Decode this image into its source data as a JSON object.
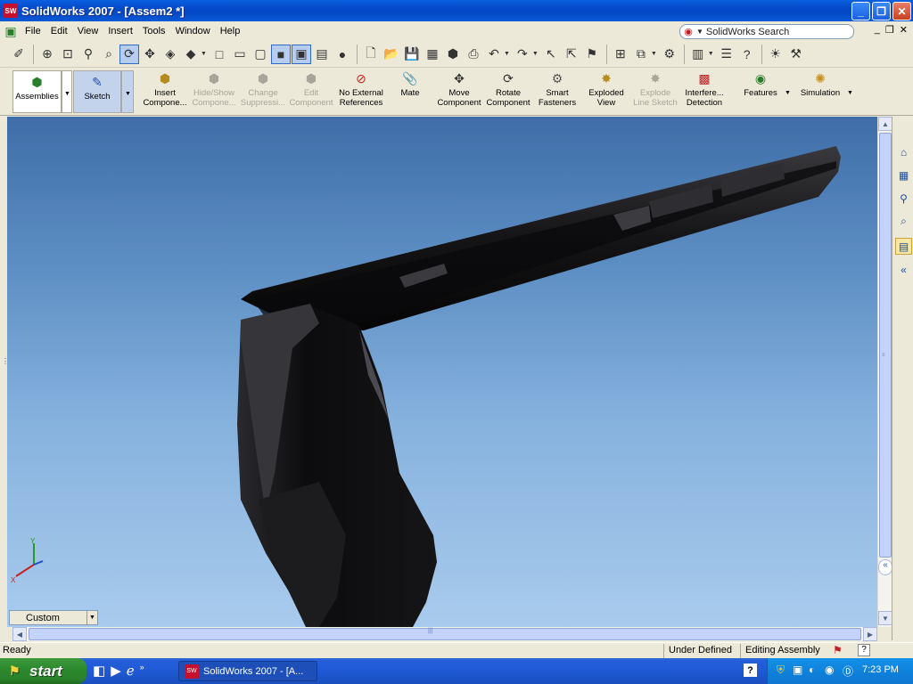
{
  "window": {
    "title": "SolidWorks 2007 - [Assem2 *]",
    "app_icon": "solidworks-logo-icon",
    "controls": [
      "_",
      "❐",
      "✕"
    ]
  },
  "menubar": {
    "items": [
      "File",
      "Edit",
      "View",
      "Insert",
      "Tools",
      "Window",
      "Help"
    ],
    "search_placeholder": "SolidWorks Search",
    "mdi_controls": [
      "_",
      "❐",
      "✕"
    ]
  },
  "command_manager": {
    "items": [
      {
        "label": "Assemblies",
        "icon": "assemblies-icon",
        "state": "tab"
      },
      {
        "label": "Sketch",
        "icon": "sketch-icon",
        "state": "tab-selected"
      },
      {
        "label": "Insert Compone...",
        "icon": "insert-component-icon",
        "state": "enabled"
      },
      {
        "label": "Hide/Show Compone...",
        "icon": "hide-show-component-icon",
        "state": "disabled"
      },
      {
        "label": "Change Suppressi...",
        "icon": "change-suppression-icon",
        "state": "disabled"
      },
      {
        "label": "Edit Component",
        "icon": "edit-component-icon",
        "state": "disabled"
      },
      {
        "label": "No External References",
        "icon": "no-external-references-icon",
        "state": "enabled"
      },
      {
        "label": "Mate",
        "icon": "mate-icon",
        "state": "enabled"
      },
      {
        "label": "Move Component",
        "icon": "move-component-icon",
        "state": "enabled"
      },
      {
        "label": "Rotate Component",
        "icon": "rotate-component-icon",
        "state": "enabled"
      },
      {
        "label": "Smart Fasteners",
        "icon": "smart-fasteners-icon",
        "state": "enabled"
      },
      {
        "label": "Exploded View",
        "icon": "exploded-view-icon",
        "state": "enabled"
      },
      {
        "label": "Explode Line Sketch",
        "icon": "explode-line-sketch-icon",
        "state": "disabled"
      },
      {
        "label": "Interfere... Detection",
        "icon": "interference-detection-icon",
        "state": "enabled"
      },
      {
        "label": "Features",
        "icon": "features-icon",
        "state": "enabled"
      },
      {
        "label": "Simulation",
        "icon": "simulation-icon",
        "state": "enabled"
      }
    ]
  },
  "viewport": {
    "configuration_dropdown": "Custom",
    "background_top": "#3f6ea8",
    "background_bottom": "#a9cbed",
    "part_color": "#1a1a1c"
  },
  "statusbar": {
    "left": "Ready",
    "state": "Under Defined",
    "mode": "Editing Assembly",
    "help": "?"
  },
  "taskbar": {
    "start_label": "start",
    "task_label": "SolidWorks 2007 - [A...",
    "clock": "7:23 PM",
    "tray_help": "?"
  }
}
